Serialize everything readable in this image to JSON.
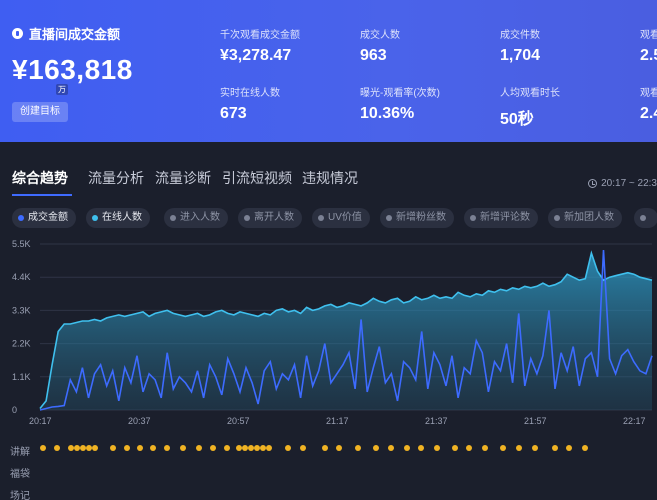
{
  "header": {
    "gmv_title": "直播间成交金额",
    "gmv_value": "¥163,818",
    "gmv_unit": "万",
    "create_goal_label": "创建目标",
    "metrics": [
      {
        "label": "千次观看成交金额",
        "value": "¥3,278.47"
      },
      {
        "label": "成交人数",
        "value": "963"
      },
      {
        "label": "成交件数",
        "value": "1,704"
      },
      {
        "label": "观看",
        "value": "2.5"
      },
      {
        "label": "实时在线人数",
        "value": "673"
      },
      {
        "label": "曝光-观看率(次数)",
        "value": "10.36%"
      },
      {
        "label": "人均观看时长",
        "value": "50秒"
      },
      {
        "label": "观看",
        "value": "2.4"
      }
    ]
  },
  "tabs": [
    "综合趋势",
    "流量分析",
    "流量诊断",
    "引流短视频",
    "违规情况"
  ],
  "time_range": "20:17 ~ 22:3",
  "legend": [
    {
      "label": "成交金额",
      "active": true,
      "color": "#3d6bff"
    },
    {
      "label": "在线人数",
      "active": true,
      "color": "#3fc0ee"
    },
    {
      "label": "进入人数",
      "active": false
    },
    {
      "label": "离开人数",
      "active": false
    },
    {
      "label": "UV价值",
      "active": false
    },
    {
      "label": "新增粉丝数",
      "active": false
    },
    {
      "label": "新增评论数",
      "active": false
    },
    {
      "label": "新加团人数",
      "active": false
    }
  ],
  "chart_data": {
    "type": "area",
    "y_ticks": [
      "5.5K",
      "4.4K",
      "3.3K",
      "2.2K",
      "1.1K",
      "0"
    ],
    "ylim": [
      0,
      5500
    ],
    "x_ticks": [
      "20:17",
      "20:37",
      "20:57",
      "21:17",
      "21:37",
      "21:57",
      "22:17"
    ],
    "series": [
      {
        "name": "在线人数",
        "type": "area",
        "values": [
          50,
          300,
          1500,
          2600,
          2850,
          2850,
          2900,
          2950,
          2950,
          3000,
          2950,
          3050,
          3100,
          3150,
          3100,
          3150,
          3200,
          3250,
          3100,
          3200,
          3250,
          3300,
          3200,
          3150,
          3100,
          3150,
          3200,
          3100,
          3150,
          3250,
          3300,
          3200,
          3150,
          3250,
          3200,
          3150,
          3100,
          3200,
          3150,
          3300,
          3350,
          3250,
          3300,
          3200,
          3400,
          3300,
          3350,
          3450,
          3500,
          3400,
          3450,
          3550,
          3500,
          3450,
          3550,
          3700,
          3600,
          3550,
          3650,
          3700,
          3550,
          3600,
          3750,
          3650,
          3700,
          3800,
          3700,
          3750,
          3700,
          3900,
          3800,
          3750,
          3850,
          3800,
          3950,
          3900,
          4000,
          3950,
          4050,
          4000,
          4100,
          4050,
          4100,
          4200,
          4100,
          4150,
          4250,
          4500,
          4400,
          4300,
          4350,
          5200,
          4600,
          4300,
          4400,
          4450,
          4500,
          4550,
          4500,
          4400,
          4350,
          4300
        ]
      },
      {
        "name": "成交金额",
        "type": "line",
        "values": [
          0,
          50,
          100,
          120,
          150,
          1000,
          600,
          1400,
          400,
          1200,
          1500,
          800,
          1300,
          300,
          1400,
          900,
          1800,
          600,
          1200,
          1000,
          400,
          1900,
          700,
          1100,
          900,
          600,
          1300,
          400,
          1500,
          1100,
          500,
          1700,
          1200,
          600,
          1400,
          900,
          200,
          1300,
          1600,
          700,
          1200,
          1000,
          1500,
          400,
          1800,
          800,
          1300,
          2200,
          900,
          1200,
          1500,
          1900,
          700,
          3000,
          600,
          1400,
          2100,
          900,
          1200,
          300,
          1600,
          1400,
          1000,
          2600,
          700,
          1900,
          1500,
          800,
          1800,
          400,
          1400,
          1200,
          2300,
          1900,
          600,
          1600,
          1300,
          2200,
          900,
          3200,
          800,
          1700,
          1200,
          1800,
          3300,
          700,
          1900,
          1300,
          2100,
          800,
          1700,
          1900,
          1100,
          5300,
          1700,
          1200,
          1800,
          2000,
          1600,
          1300,
          1200,
          1800
        ]
      }
    ],
    "events": [
      {
        "label": "讲解",
        "count": 41
      },
      {
        "label": "福袋",
        "count": 0
      },
      {
        "label": "场记",
        "count": 0
      }
    ]
  }
}
